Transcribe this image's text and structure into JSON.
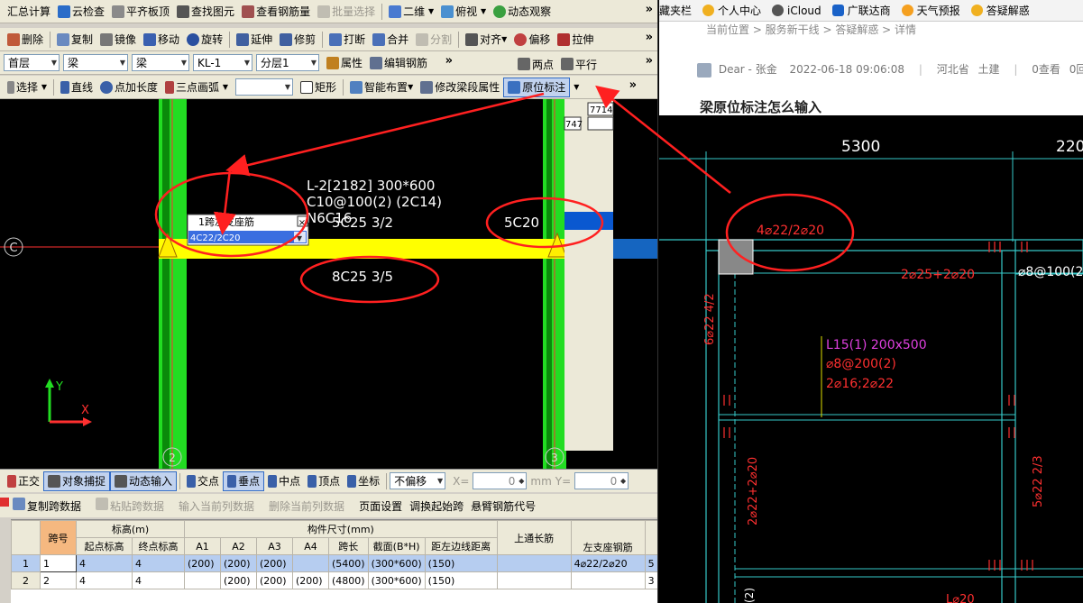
{
  "toolbar1": {
    "items": [
      "汇总计算",
      "云检查",
      "平齐板顶",
      "查找图元",
      "查看钢筋量",
      "批量选择",
      "二维",
      "俯视",
      "动态观察"
    ]
  },
  "toolbar2": {
    "items": [
      "删除",
      "复制",
      "镜像",
      "移动",
      "旋转",
      "延伸",
      "修剪",
      "打断",
      "合并",
      "分割",
      "对齐",
      "偏移",
      "拉伸"
    ]
  },
  "toolbar3": {
    "floor": "首层",
    "type1": "梁",
    "type2": "梁",
    "component": "KL-1",
    "layer": "分层1",
    "property_label": "属性",
    "edit_rebar_label": "编辑钢筋",
    "two_point_label": "两点",
    "parallel_label": "平行"
  },
  "toolbar4": {
    "items": [
      "选择",
      "直线",
      "点加长度",
      "三点画弧",
      "矩形",
      "智能布置",
      "修改梁段属性",
      "原位标注"
    ]
  },
  "canvas": {
    "beam_label_line1": "L-2[2182] 300*600",
    "beam_label_line2": "C10@100(2) (2C14)",
    "beam_label_line3": "N6C16",
    "top_mid_rebar": "5C25 3/2",
    "right_support_rebar": "5C20",
    "bottom_rebar": "8C25 3/5",
    "axis_c": "C",
    "axis_2": "2",
    "axis_3": "3",
    "popup_title": "1跨左支座筋",
    "popup_value": "4C22/2C20",
    "box_num1": "7714",
    "box_num2": "747",
    "y_label": "Y",
    "x_label": "X"
  },
  "statusbar": {
    "items": [
      "正交",
      "对象捕捉",
      "动态输入",
      "交点",
      "垂点",
      "中点",
      "顶点",
      "坐标"
    ],
    "offset_mode": "不偏移",
    "x_label": "X=",
    "x_value": "0",
    "unit": "mm",
    "y_label": "Y=",
    "y_value": "0"
  },
  "panel_toolbar": {
    "items": [
      "复制跨数据",
      "粘贴跨数据",
      "输入当前列数据",
      "删除当前列数据",
      "页面设置",
      "调换起始跨",
      "悬臂钢筋代号"
    ]
  },
  "table": {
    "h_span": "跨号",
    "h_elev": "标高(m)",
    "h_size": "构件尺寸(mm)",
    "h_top": "上通长筋",
    "h_start": "起点标高",
    "h_end": "终点标高",
    "h_a1": "A1",
    "h_a2": "A2",
    "h_a3": "A3",
    "h_a4": "A4",
    "h_len": "跨长",
    "h_sec": "截面(B*H)",
    "h_dist": "距左边线距离",
    "h_left": "左支座钢筋",
    "rows": [
      {
        "idx": "1",
        "span": "1",
        "start": "4",
        "end": "4",
        "a1": "(200)",
        "a2": "(200)",
        "a3": "(200)",
        "a4": "",
        "len": "(5400)",
        "sec": "(300*600)",
        "dist": "(150)",
        "top": "",
        "left": "4⌀22/2⌀20",
        "more": "5"
      },
      {
        "idx": "2",
        "span": "2",
        "start": "4",
        "end": "4",
        "a1": "",
        "a2": "(200)",
        "a3": "(200)",
        "a4": "(200)",
        "len": "(4800)",
        "sec": "(300*600)",
        "dist": "(150)",
        "top": "",
        "left": "",
        "more": "3"
      }
    ]
  },
  "web": {
    "bookmarks": [
      "藏夹栏",
      "个人中心",
      "iCloud",
      "广联达商",
      "天气预报",
      "答疑解惑"
    ],
    "breadcrumb": "当前位置 > 服务新干线 > 答疑解惑 > 详情",
    "author": "Dear - 张金",
    "datetime": "2022-06-18 09:06:08",
    "region": "河北省",
    "category": "土建",
    "views": "0查看",
    "replies": "0回",
    "title": "梁原位标注怎么输入",
    "dim_left": "5300",
    "dim_right": "220",
    "annot_support": "4⌀22/2⌀20",
    "annot_mid": "2⌀25+2⌀20",
    "annot_stirrup": "⌀8@100(2)",
    "annot_l15_1": "L15(1) 200x500",
    "annot_l15_2": "⌀8@200(2)",
    "annot_l15_3": "2⌀16;2⌀22",
    "annot_vert_left": "6⌀22 4/2",
    "annot_vert_left2": "2⌀22+2⌀20",
    "annot_vert_right": "5⌀22 2/3",
    "annot_bottom": "L⌀20",
    "annot_bottom_left": "(2)"
  },
  "colors": {
    "column_green": "#22dd22",
    "beam_yellow": "#ffff00",
    "annotation_red": "#ff3030",
    "cad_cyan": "#36c8c8",
    "magenta": "#e040e0"
  }
}
